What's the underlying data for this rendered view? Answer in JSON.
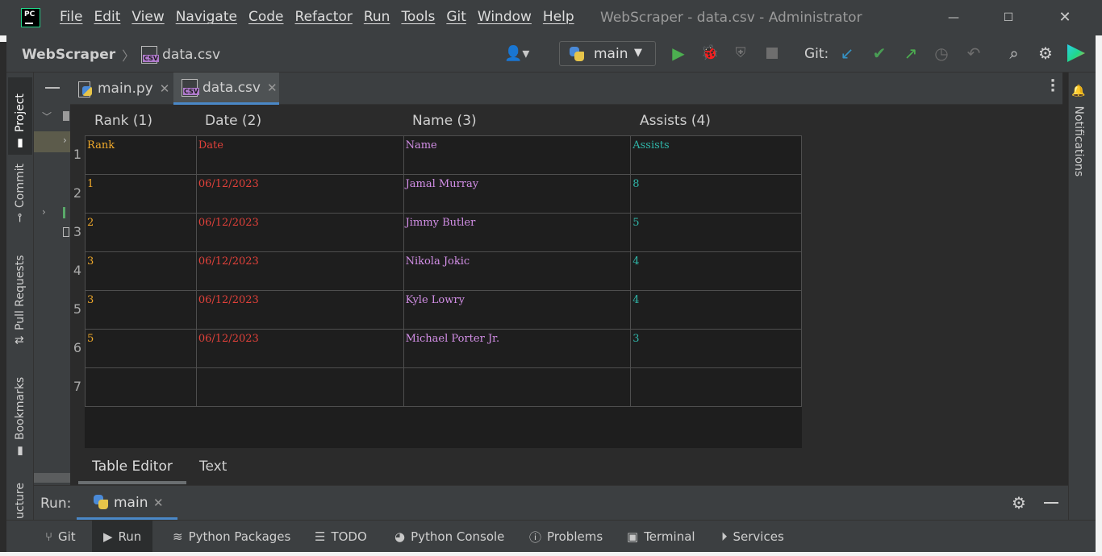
{
  "window": {
    "title": "WebScraper - data.csv - Administrator",
    "logo_text": "PC",
    "minimize": "—",
    "maximize": "☐",
    "close": "✕"
  },
  "menu": [
    "File",
    "Edit",
    "View",
    "Navigate",
    "Code",
    "Refactor",
    "Run",
    "Tools",
    "Git",
    "Window",
    "Help"
  ],
  "breadcrumb": {
    "project": "WebScraper",
    "file": "data.csv",
    "separator": "〉"
  },
  "toolbar": {
    "run_config": "main",
    "git_label": "Git:"
  },
  "left_tabs": {
    "project": "Project",
    "commit": "Commit",
    "pull_requests": "Pull Requests",
    "bookmarks": "Bookmarks",
    "structure": "ucture"
  },
  "right_tabs": {
    "notifications": "Notifications"
  },
  "editor_tabs": [
    {
      "label": "main.py",
      "active": false
    },
    {
      "label": "data.csv",
      "active": true
    }
  ],
  "table": {
    "columns": [
      "Rank (1)",
      "Date (2)",
      "Name (3)",
      "Assists (4)"
    ],
    "row_numbers": [
      "1",
      "2",
      "3",
      "4",
      "5",
      "6",
      "7"
    ],
    "rows": [
      [
        "Rank",
        "Date",
        "Name",
        "Assists"
      ],
      [
        "1",
        "06/12/2023",
        "Jamal Murray",
        "8"
      ],
      [
        "2",
        "06/12/2023",
        "Jimmy Butler",
        "5"
      ],
      [
        "3",
        "06/12/2023",
        "Nikola Jokic",
        "4"
      ],
      [
        "3",
        "06/12/2023",
        "Kyle Lowry",
        "4"
      ],
      [
        "5",
        "06/12/2023",
        "Michael Porter Jr.",
        "3"
      ],
      [
        "",
        "",
        "",
        ""
      ]
    ],
    "column_colors": [
      "#f0a92b",
      "#e2413a",
      "#d38fe7",
      "#2fb5a8"
    ]
  },
  "view_tabs": {
    "table_editor": "Table Editor",
    "text": "Text"
  },
  "run_panel": {
    "label": "Run:",
    "tab": "main"
  },
  "bottom_tabs": {
    "git": "Git",
    "run": "Run",
    "python_packages": "Python Packages",
    "todo": "TODO",
    "python_console": "Python Console",
    "problems": "Problems",
    "terminal": "Terminal",
    "services": "Services"
  },
  "colors": {
    "accent": "#4a88c7",
    "run_green": "#4caf50",
    "background": "#2b2b2b",
    "panel": "#3c3f41"
  }
}
